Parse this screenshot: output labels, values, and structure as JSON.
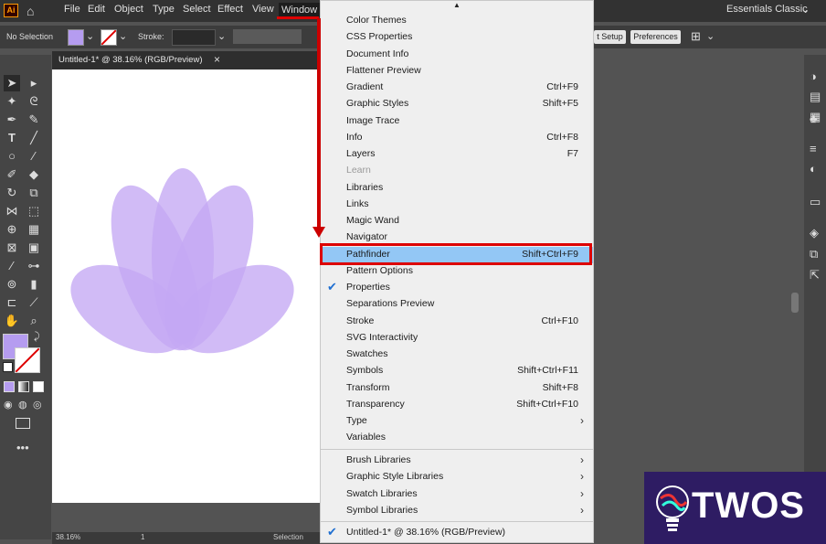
{
  "menubar": {
    "app_logo": "Ai",
    "items": [
      "File",
      "Edit",
      "Object",
      "Type",
      "Select",
      "Effect",
      "View",
      "Window"
    ],
    "workspace": "Essentials Classic"
  },
  "controlbar": {
    "selection_status": "No Selection",
    "stroke_label": "Stroke:",
    "doc_setup": "t Setup",
    "preferences": "Preferences"
  },
  "tab": {
    "title": "Untitled-1* @ 38.16% (RGB/Preview)",
    "close": "×"
  },
  "status": {
    "zoom": "38.16%",
    "artboard": "1",
    "tool": "Selection"
  },
  "window_menu": {
    "items": [
      {
        "label": "Color Themes",
        "shortcut": ""
      },
      {
        "label": "CSS Properties",
        "shortcut": ""
      },
      {
        "label": "Document Info",
        "shortcut": ""
      },
      {
        "label": "Flattener Preview",
        "shortcut": ""
      },
      {
        "label": "Gradient",
        "shortcut": "Ctrl+F9"
      },
      {
        "label": "Graphic Styles",
        "shortcut": "Shift+F5"
      },
      {
        "label": "Image Trace",
        "shortcut": ""
      },
      {
        "label": "Info",
        "shortcut": "Ctrl+F8"
      },
      {
        "label": "Layers",
        "shortcut": "F7"
      },
      {
        "label": "Learn",
        "shortcut": ""
      },
      {
        "label": "Libraries",
        "shortcut": ""
      },
      {
        "label": "Links",
        "shortcut": ""
      },
      {
        "label": "Magic Wand",
        "shortcut": ""
      },
      {
        "label": "Navigator",
        "shortcut": ""
      },
      {
        "label": "Pathfinder",
        "shortcut": "Shift+Ctrl+F9"
      },
      {
        "label": "Pattern Options",
        "shortcut": ""
      },
      {
        "label": "Properties",
        "shortcut": ""
      },
      {
        "label": "Separations Preview",
        "shortcut": ""
      },
      {
        "label": "Stroke",
        "shortcut": "Ctrl+F10"
      },
      {
        "label": "SVG Interactivity",
        "shortcut": ""
      },
      {
        "label": "Swatches",
        "shortcut": ""
      },
      {
        "label": "Symbols",
        "shortcut": "Shift+Ctrl+F11"
      },
      {
        "label": "Transform",
        "shortcut": "Shift+F8"
      },
      {
        "label": "Transparency",
        "shortcut": "Shift+Ctrl+F10"
      },
      {
        "label": "Type",
        "shortcut": ""
      },
      {
        "label": "Variables",
        "shortcut": ""
      }
    ],
    "libraries": [
      {
        "label": "Brush Libraries"
      },
      {
        "label": "Graphic Style Libraries"
      },
      {
        "label": "Swatch Libraries"
      },
      {
        "label": "Symbol Libraries"
      }
    ],
    "open_document": "Untitled-1* @ 38.16% (RGB/Preview)",
    "highlighted": "Pathfinder",
    "checked": "Properties",
    "disabled": "Learn"
  },
  "watermark": {
    "text": "TWOS"
  },
  "colors": {
    "fill_swatch": "#b59cf0",
    "petal": "#c4a8f4",
    "highlight": "#93c7f5",
    "annotation": "#dd0000"
  }
}
